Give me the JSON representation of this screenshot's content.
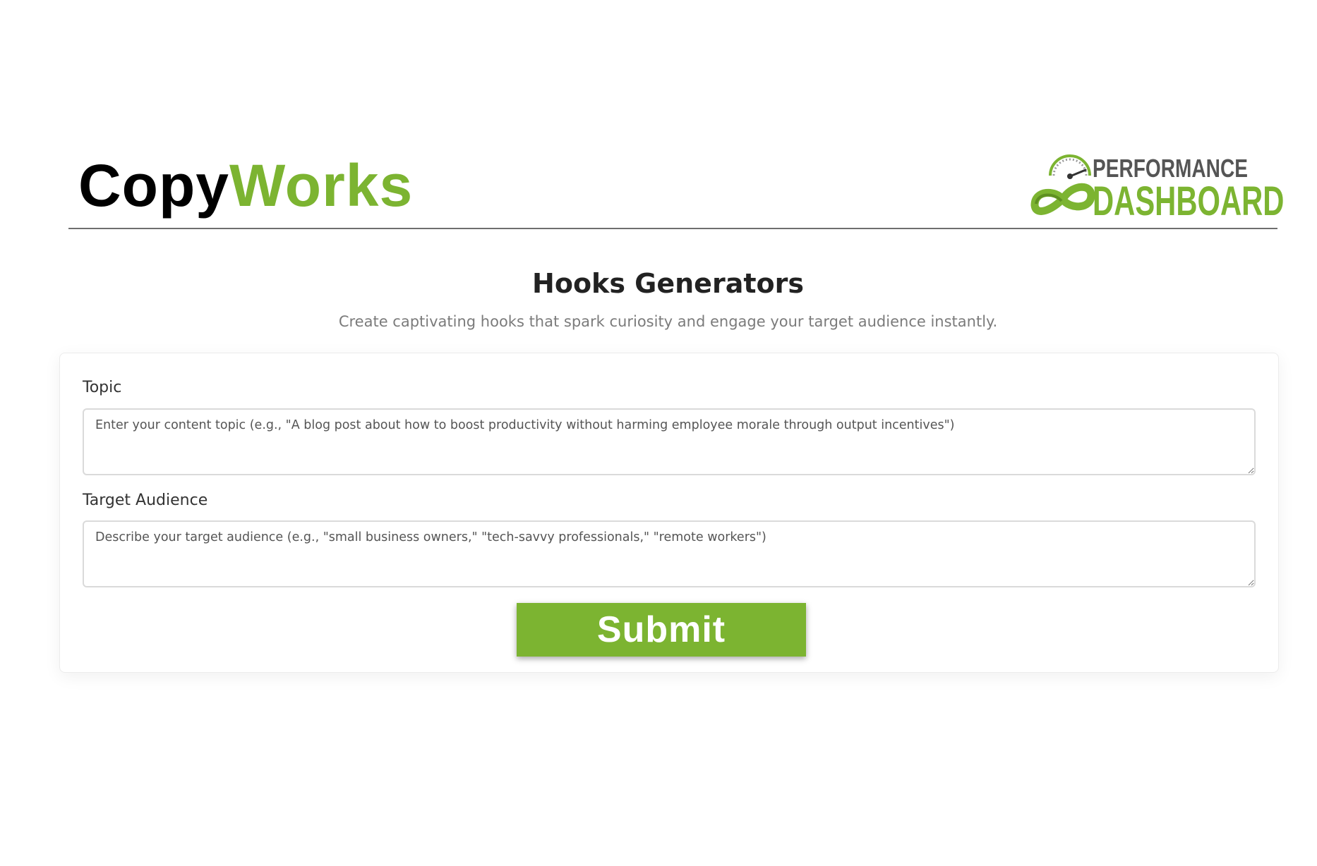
{
  "header": {
    "brand_part_a": "Copy",
    "brand_part_b": "Works",
    "logo_top": "PERFORMANCE",
    "logo_bottom": "DASHBOARD"
  },
  "main": {
    "title": "Hooks Generators",
    "subtitle": "Create captivating hooks that spark curiosity and engage your target audience instantly."
  },
  "form": {
    "topic_label": "Topic",
    "topic_placeholder": "Enter your content topic (e.g., \"A blog post about how to boost productivity without harming employee morale through output incentives\")",
    "audience_label": "Target Audience",
    "audience_placeholder": "Describe your target audience (e.g., \"small business owners,\" \"tech-savvy professionals,\" \"remote workers\")",
    "submit_label": "Submit"
  },
  "colors": {
    "accent_green": "#7cb431",
    "divider": "#6f6f6f",
    "text_dark": "#222222",
    "text_muted": "#7b7b7b"
  },
  "icons": {
    "logo_mark": "speedometer-infinity-icon"
  }
}
